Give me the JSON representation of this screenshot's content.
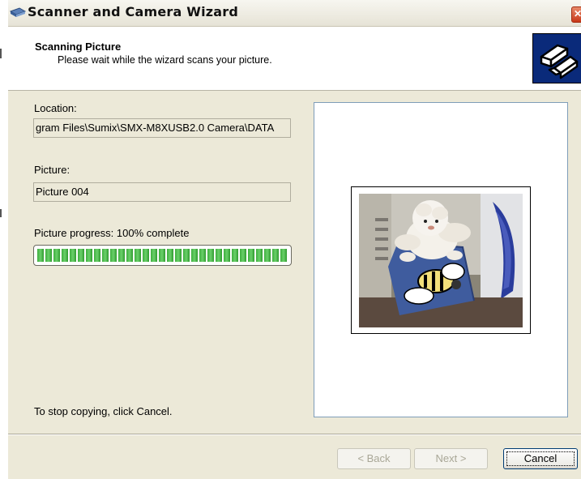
{
  "window": {
    "title": "Scanner and Camera Wizard",
    "close_label": "✕"
  },
  "header": {
    "title": "Scanning Picture",
    "subtitle": "Please wait while the wizard scans your picture."
  },
  "form": {
    "location_label": "Location:",
    "location_value": "gram Files\\Sumix\\SMX-M8XUSB2.0 Camera\\DATA",
    "picture_label": "Picture:",
    "picture_value": "Picture 004",
    "progress_label": "Picture progress: 100% complete",
    "progress_percent": 100,
    "stop_hint": "To stop copying, click Cancel."
  },
  "buttons": {
    "back_label": "< Back",
    "next_label": "Next >",
    "cancel_label": "Cancel"
  },
  "colors": {
    "dialog_bg": "#ece9d8",
    "progress_green": "#3fae3f",
    "logo_bg": "#0a2a7a"
  }
}
